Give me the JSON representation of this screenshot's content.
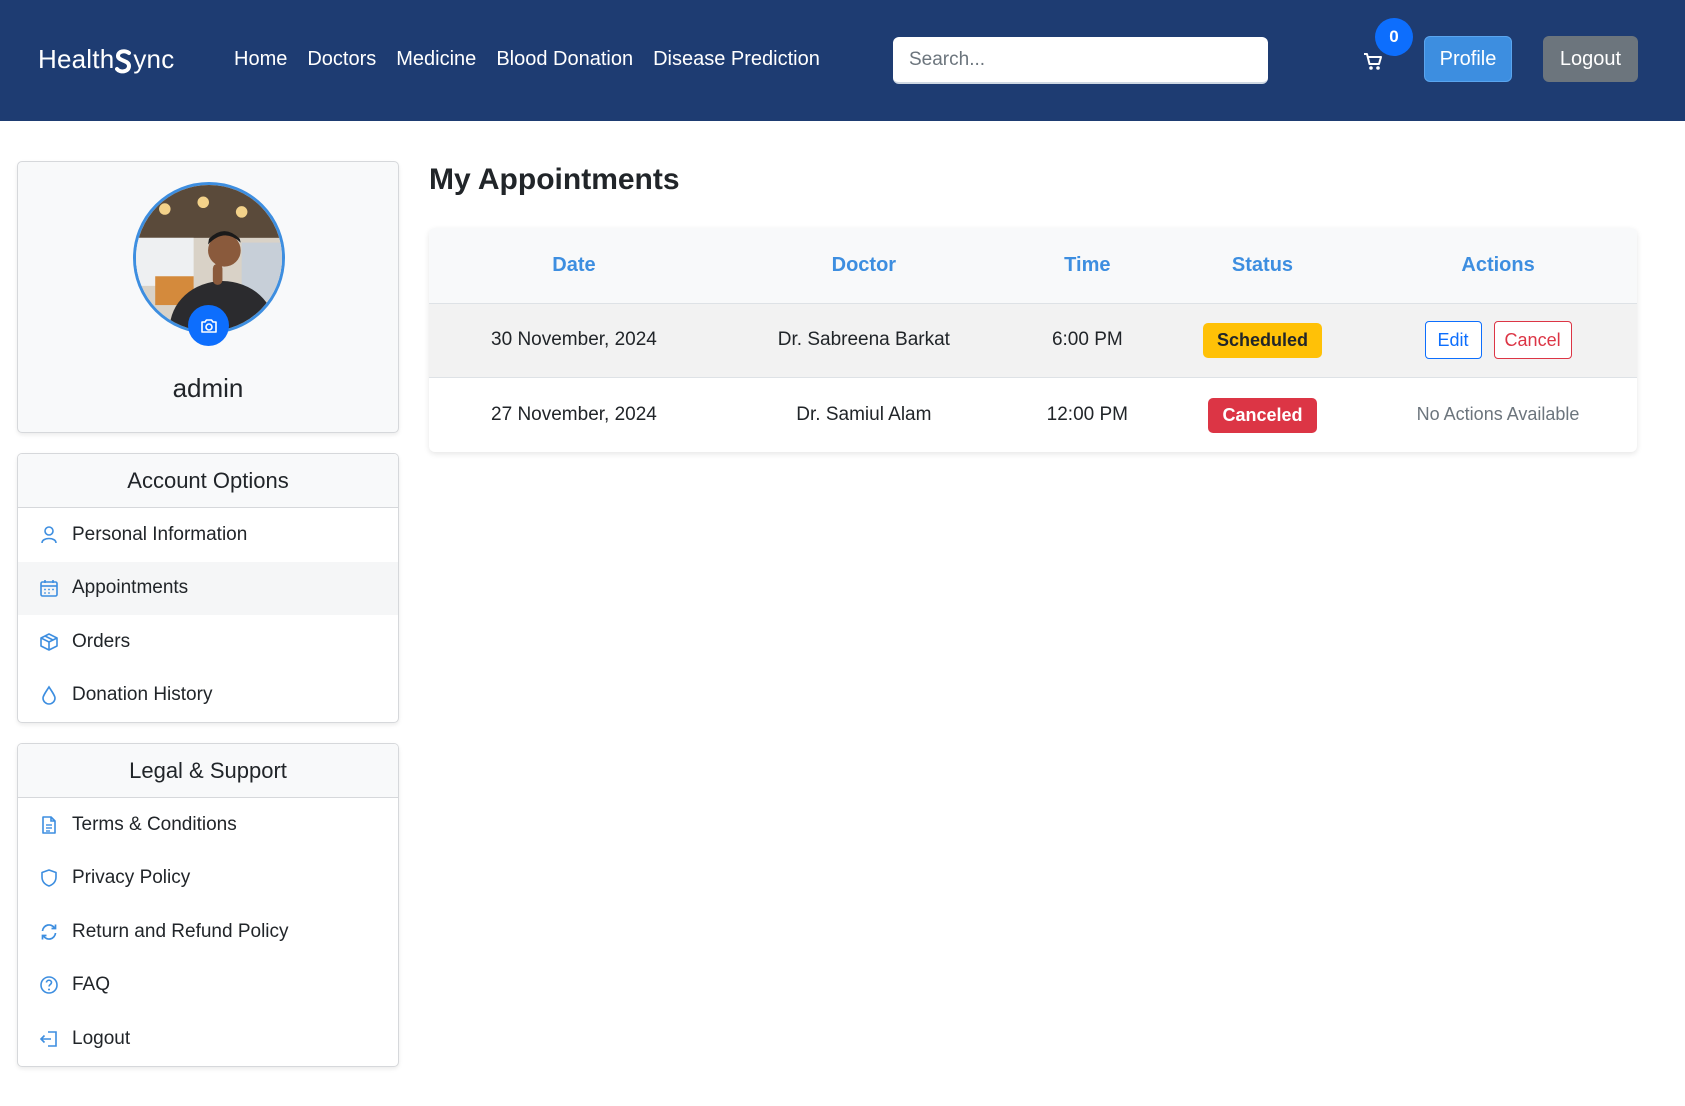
{
  "navbar": {
    "brand_part1": "Health",
    "brand_part2": "ync",
    "links": [
      "Home",
      "Doctors",
      "Medicine",
      "Blood Donation",
      "Disease Prediction"
    ],
    "search_placeholder": "Search...",
    "cart_count": "0",
    "profile_label": "Profile",
    "logout_label": "Logout",
    "colors": {
      "bar": "#1e3c72",
      "profile_btn": "#3d8ee0",
      "logout_btn": "#6c757d",
      "badge": "#0d6efd"
    }
  },
  "profile": {
    "username": "admin",
    "avatar_icon": "user-photo",
    "camera_icon": "camera-icon"
  },
  "account_options": {
    "title": "Account Options",
    "items": [
      {
        "label": "Personal Information",
        "icon": "person-icon"
      },
      {
        "label": "Appointments",
        "icon": "calendar-icon",
        "active": true
      },
      {
        "label": "Orders",
        "icon": "box-icon"
      },
      {
        "label": "Donation History",
        "icon": "droplet-icon"
      }
    ]
  },
  "legal_support": {
    "title": "Legal & Support",
    "items": [
      {
        "label": "Terms & Conditions",
        "icon": "document-icon"
      },
      {
        "label": "Privacy Policy",
        "icon": "shield-icon"
      },
      {
        "label": "Return and Refund Policy",
        "icon": "refresh-icon"
      },
      {
        "label": "FAQ",
        "icon": "question-icon"
      },
      {
        "label": "Logout",
        "icon": "logout-icon"
      }
    ]
  },
  "main": {
    "title": "My Appointments",
    "columns": [
      "Date",
      "Doctor",
      "Time",
      "Status",
      "Actions"
    ],
    "rows": [
      {
        "date": "30 November, 2024",
        "doctor": "Dr. Sabreena Barkat",
        "time": "6:00 PM",
        "status": "Scheduled",
        "edit": "Edit",
        "cancel": "Cancel"
      },
      {
        "date": "27 November, 2024",
        "doctor": "Dr. Samiul Alam",
        "time": "12:00 PM",
        "status": "Canceled",
        "no_actions": "No Actions Available"
      }
    ],
    "colors": {
      "header_text": "#3d8ee0",
      "scheduled": "#ffc107",
      "canceled": "#dc3545"
    }
  }
}
